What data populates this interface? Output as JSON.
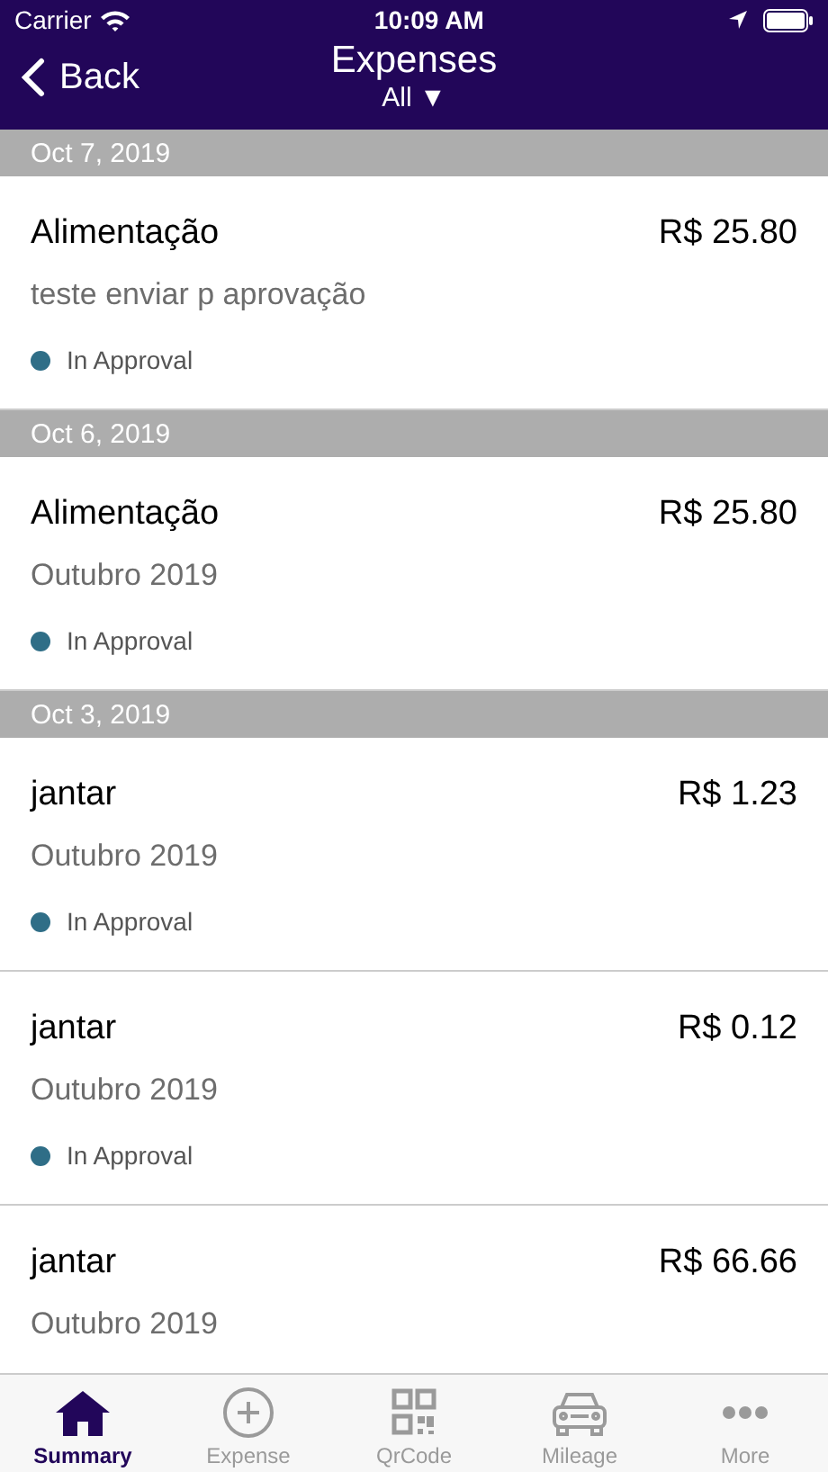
{
  "status_bar": {
    "carrier": "Carrier",
    "time": "10:09 AM"
  },
  "nav": {
    "back": "Back",
    "title": "Expenses",
    "filter": "All ▼"
  },
  "sections": [
    {
      "date": "Oct 7, 2019",
      "items": [
        {
          "category": "Alimentação",
          "amount": "R$ 25.80",
          "description": "teste enviar p aprovação",
          "status": "In Approval",
          "color": "#2f6e87"
        }
      ]
    },
    {
      "date": "Oct 6, 2019",
      "items": [
        {
          "category": "Alimentação",
          "amount": "R$ 25.80",
          "description": "Outubro 2019",
          "status": "In Approval",
          "color": "#2f6e87"
        }
      ]
    },
    {
      "date": "Oct 3, 2019",
      "items": [
        {
          "category": "jantar",
          "amount": "R$ 1.23",
          "description": "Outubro 2019",
          "status": "In Approval",
          "color": "#2f6e87"
        },
        {
          "category": "jantar",
          "amount": "R$ 0.12",
          "description": "Outubro 2019",
          "status": "In Approval",
          "color": "#2f6e87"
        },
        {
          "category": "jantar",
          "amount": "R$ 66.66",
          "description": "Outubro 2019"
        }
      ]
    }
  ],
  "tabs": [
    {
      "label": "Summary",
      "kind": "home",
      "selected": true
    },
    {
      "label": "Expense",
      "kind": "plus",
      "selected": false
    },
    {
      "label": "QrCode",
      "kind": "qr",
      "selected": false
    },
    {
      "label": "Mileage",
      "kind": "car",
      "selected": false
    },
    {
      "label": "More",
      "kind": "more",
      "selected": false
    }
  ]
}
